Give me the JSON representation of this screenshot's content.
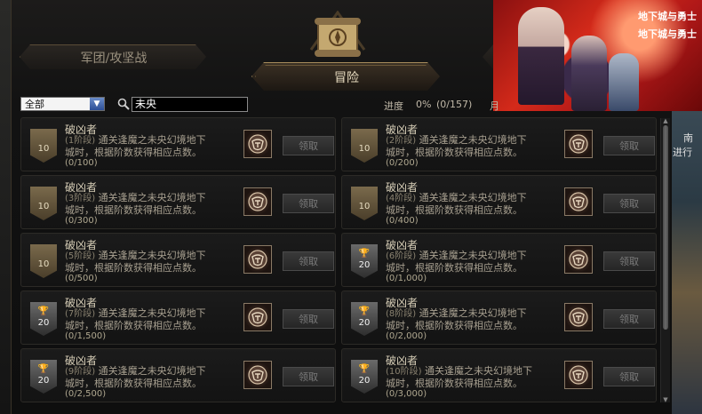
{
  "tabs": {
    "guild_war": "军团/攻坚战",
    "adventure": "冒险"
  },
  "filter": {
    "category_selected": "全部",
    "search_value": "未央"
  },
  "progress": {
    "label": "进度",
    "percent": "0%",
    "count": "(0/157)",
    "extra": "月"
  },
  "side_text": [
    "南",
    "进行"
  ],
  "banner": {
    "logo_line1": "地下城与勇士",
    "logo_line2": "地下城与勇士"
  },
  "claim_label": "领取",
  "achievements": [
    {
      "title": "破凶者",
      "level": "(1阶段)",
      "desc_a": "通关逢魔之未央幻境地下",
      "desc_b": "城时，根据阶数获得相应点数。",
      "progress": "(0/100)",
      "points": "10",
      "badge": "bronze"
    },
    {
      "title": "破凶者",
      "level": "(2阶段)",
      "desc_a": "通关逢魔之未央幻境地下",
      "desc_b": "城时，根据阶数获得相应点数。",
      "progress": "(0/200)",
      "points": "10",
      "badge": "bronze"
    },
    {
      "title": "破凶者",
      "level": "(3阶段)",
      "desc_a": "通关逢魔之未央幻境地下",
      "desc_b": "城时，根据阶数获得相应点数。",
      "progress": "(0/300)",
      "points": "10",
      "badge": "bronze"
    },
    {
      "title": "破凶者",
      "level": "(4阶段)",
      "desc_a": "通关逢魔之未央幻境地下",
      "desc_b": "城时，根据阶数获得相应点数。",
      "progress": "(0/400)",
      "points": "10",
      "badge": "bronze"
    },
    {
      "title": "破凶者",
      "level": "(5阶段)",
      "desc_a": "通关逢魔之未央幻境地下",
      "desc_b": "城时，根据阶数获得相应点数。",
      "progress": "(0/500)",
      "points": "10",
      "badge": "bronze"
    },
    {
      "title": "破凶者",
      "level": "(6阶段)",
      "desc_a": "通关逢魔之未央幻境地下",
      "desc_b": "城时，根据阶数获得相应点数。",
      "progress": "(0/1,000)",
      "points": "20",
      "badge": "trophy"
    },
    {
      "title": "破凶者",
      "level": "(7阶段)",
      "desc_a": "通关逢魔之未央幻境地下",
      "desc_b": "城时，根据阶数获得相应点数。",
      "progress": "(0/1,500)",
      "points": "20",
      "badge": "trophy"
    },
    {
      "title": "破凶者",
      "level": "(8阶段)",
      "desc_a": "通关逢魔之未央幻境地下",
      "desc_b": "城时，根据阶数获得相应点数。",
      "progress": "(0/2,000)",
      "points": "20",
      "badge": "trophy"
    },
    {
      "title": "破凶者",
      "level": "(9阶段)",
      "desc_a": "通关逢魔之未央幻境地下",
      "desc_b": "城时，根据阶数获得相应点数。",
      "progress": "(0/2,500)",
      "points": "20",
      "badge": "trophy"
    },
    {
      "title": "破凶者",
      "level": "(10阶段)",
      "desc_a": "通关逢魔之未央幻境地下",
      "desc_b": "城时，根据阶数获得相应点数。",
      "progress": "(0/3,000)",
      "points": "20",
      "badge": "trophy"
    }
  ]
}
